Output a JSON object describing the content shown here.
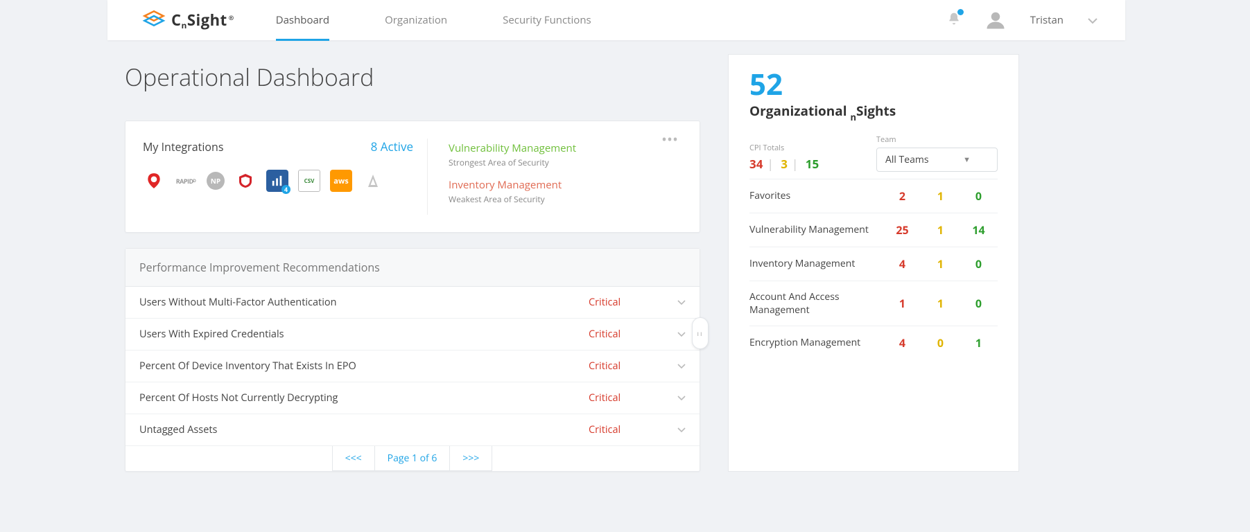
{
  "brand": {
    "name_a": "C",
    "name_sub": "n",
    "name_b": "Sight"
  },
  "nav": {
    "dashboard": "Dashboard",
    "organization": "Organization",
    "security": "Security Functions"
  },
  "user": {
    "name": "Tristan"
  },
  "title": "Operational Dashboard",
  "integrations": {
    "label": "My Integrations",
    "active": "8 Active",
    "icons": {
      "q": "Q",
      "r": "RAPIDᴰ",
      "np": "NP",
      "m": "M",
      "bar": "⫴",
      "csv": "CSV",
      "aws": "aws",
      "az": "◬"
    },
    "strongest": {
      "title": "Vulnerability Management",
      "sub": "Strongest Area of Security"
    },
    "weakest": {
      "title": "Inventory Management",
      "sub": "Weakest Area of Security"
    }
  },
  "pir": {
    "heading": "Performance Improvement Recommendations",
    "rows": [
      {
        "name": "Users Without Multi-Factor Authentication",
        "sev": "Critical"
      },
      {
        "name": "Users With Expired Credentials",
        "sev": "Critical"
      },
      {
        "name": "Percent Of Device Inventory That Exists In EPO",
        "sev": "Critical"
      },
      {
        "name": "Percent Of Hosts Not Currently Decrypting",
        "sev": "Critical"
      },
      {
        "name": "Untagged Assets",
        "sev": "Critical"
      }
    ],
    "pager": {
      "prev": "<<<",
      "page": "Page 1 of 6",
      "next": ">>>"
    }
  },
  "sights": {
    "total": "52",
    "title_a": "Organizational ",
    "title_sub": "n",
    "title_b": "Sights",
    "cpi_label": "CPI Totals",
    "cpi": {
      "r": "34",
      "y": "3",
      "g": "15"
    },
    "team_label": "Team",
    "team_selected": "All Teams",
    "rows": [
      {
        "name": "Favorites",
        "r": "2",
        "y": "1",
        "g": "0"
      },
      {
        "name": "Vulnerability Management",
        "r": "25",
        "y": "1",
        "g": "14"
      },
      {
        "name": "Inventory Management",
        "r": "4",
        "y": "1",
        "g": "0"
      },
      {
        "name": "Account And Access Management",
        "r": "1",
        "y": "1",
        "g": "0"
      },
      {
        "name": "Encryption Management",
        "r": "4",
        "y": "0",
        "g": "1"
      }
    ]
  }
}
